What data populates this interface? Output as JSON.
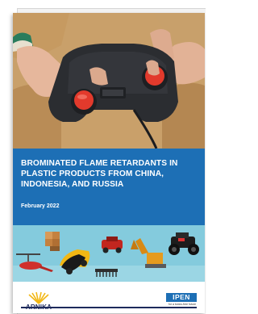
{
  "cover": {
    "title": "BROMINATED FLAME RETARDANTS IN PLASTIC PRODUCTS FROM CHINA, INDONESIA, AND RUSSIA",
    "date": "February 2022"
  },
  "logos": {
    "arnika": "ARNIKA",
    "ipen": "IPEN",
    "ipen_tagline": "for a toxics-free future"
  },
  "colors": {
    "band": "#1d6fb5",
    "toys_background": "#7fc9dc",
    "navy": "#1d2a5c"
  }
}
